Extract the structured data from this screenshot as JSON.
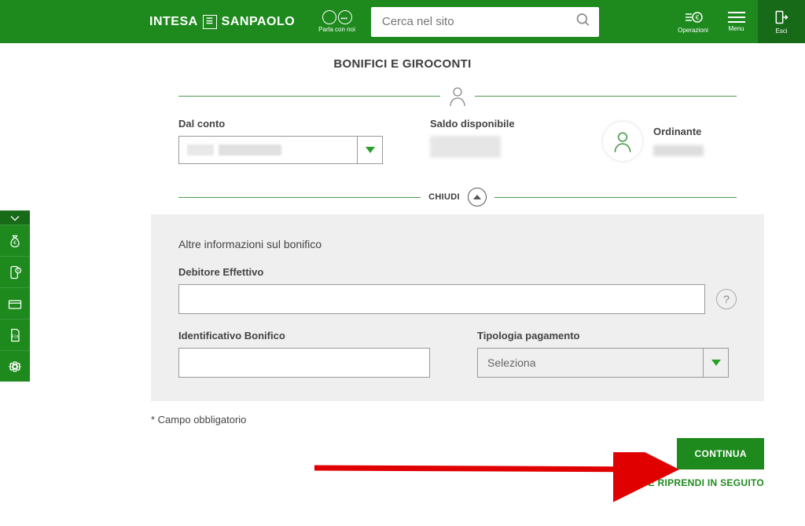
{
  "colors": {
    "brand": "#1e8a1e",
    "brand_dark": "#176a17"
  },
  "header": {
    "logo_left": "INTESA",
    "logo_right": "SANPAOLO",
    "chat_label": "Parla con noi",
    "search_placeholder": "Cerca nel sito",
    "actions": {
      "operazioni": "Operazioni",
      "menu": "Menu",
      "esci": "Esci"
    }
  },
  "page": {
    "title": "BONIFICI E GIROCONTI"
  },
  "summary": {
    "from_label": "Dal conto",
    "balance_label": "Saldo disponibile",
    "ordinante_label": "Ordinante",
    "chiudi_label": "CHIUDI"
  },
  "form": {
    "heading": "Altre informazioni sul bonifico",
    "debitore_label": "Debitore Effettivo",
    "debitore_value": "",
    "id_label": "Identificativo Bonifico",
    "id_value": "",
    "tipologia_label": "Tipologia pagamento",
    "tipologia_placeholder": "Seleziona"
  },
  "footer": {
    "required_note": "* Campo obbligatorio",
    "continua": "CONTINUA",
    "save_link": "SALVA E RIPRENDI IN SEGUITO"
  },
  "quicknav": {
    "items": [
      "moneybag-icon",
      "phone-euro-icon",
      "card-icon",
      "f24-icon",
      "gear-icon"
    ]
  }
}
